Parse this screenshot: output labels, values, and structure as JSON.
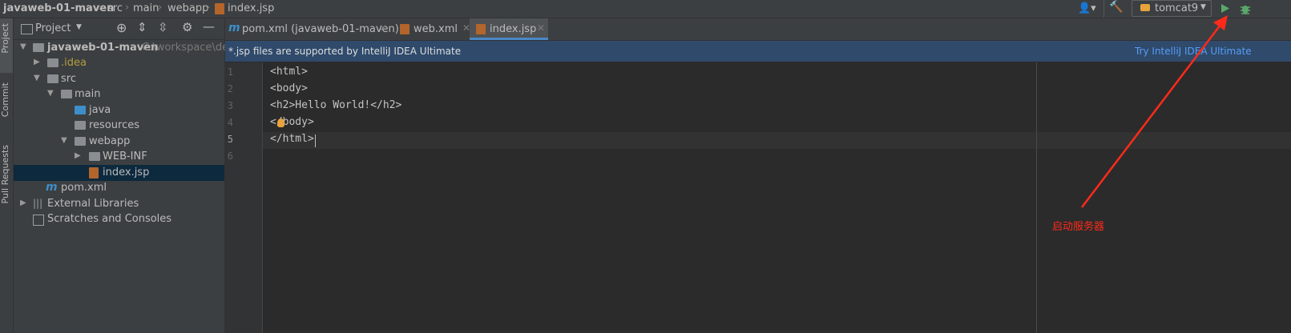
{
  "breadcrumb": [
    "javaweb-01-maven",
    "src",
    "main",
    "webapp",
    "index.jsp"
  ],
  "toolbar": {
    "run_config": "tomcat9"
  },
  "left_stripe": [
    "Project",
    "Commit",
    "Pull Requests"
  ],
  "project_panel": {
    "title": "Project",
    "tree": [
      {
        "label": "javaweb-01-maven",
        "hint": "C:\\workspace\\de"
      },
      {
        "label": ".idea"
      },
      {
        "label": "src"
      },
      {
        "label": "main"
      },
      {
        "label": "java"
      },
      {
        "label": "resources"
      },
      {
        "label": "webapp"
      },
      {
        "label": "WEB-INF"
      },
      {
        "label": "index.jsp"
      },
      {
        "label": "pom.xml"
      },
      {
        "label": "External Libraries"
      },
      {
        "label": "Scratches and Consoles"
      }
    ]
  },
  "tabs": [
    {
      "label": "pom.xml (javaweb-01-maven)"
    },
    {
      "label": "web.xml"
    },
    {
      "label": "index.jsp"
    }
  ],
  "banner": {
    "message": "*.jsp files are supported by IntelliJ IDEA Ultimate",
    "link": "Try IntelliJ IDEA Ultimate"
  },
  "editor": {
    "line_numbers": [
      "1",
      "2",
      "3",
      "4",
      "5",
      "6"
    ],
    "lines": [
      "<html>",
      "<body>",
      "<h2>Hello World!</h2>",
      "</body>",
      "</html>",
      ""
    ]
  },
  "annotation": {
    "text": "启动服务器",
    "color": "#ff2a1a"
  },
  "colors": {
    "accent": "#4a88c7",
    "run_green": "#59a869",
    "tab_underline": "#4a88c7"
  }
}
